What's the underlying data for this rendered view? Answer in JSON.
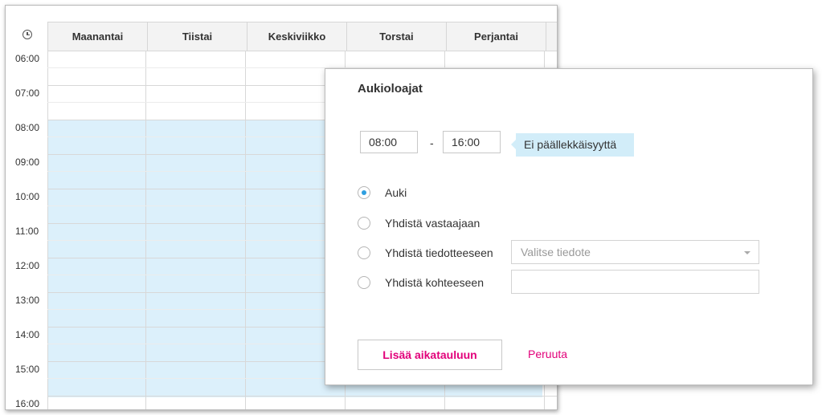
{
  "calendar": {
    "days": [
      "Maanantai",
      "Tiistai",
      "Keskiviikko",
      "Torstai",
      "Perjantai"
    ],
    "hours": [
      "06:00",
      "07:00",
      "08:00",
      "09:00",
      "10:00",
      "11:00",
      "12:00",
      "13:00",
      "14:00",
      "15:00",
      "16:00"
    ],
    "open_from": "08:00",
    "open_to": "16:00",
    "open_color": "#dcf0fb"
  },
  "dialog": {
    "title": "Aukioloajat",
    "start_time": "08:00",
    "separator": "-",
    "end_time": "16:00",
    "overlap_status": "Ei päällekkäisyyttä",
    "options": [
      {
        "label": "Auki",
        "checked": true
      },
      {
        "label": "Yhdistä vastaajaan",
        "checked": false
      },
      {
        "label": "Yhdistä tiedotteeseen",
        "checked": false
      },
      {
        "label": "Yhdistä kohteeseen",
        "checked": false
      }
    ],
    "bulletin_select_placeholder": "Valitse tiedote",
    "target_input_value": "",
    "add_button_label": "Lisää aikatauluun",
    "cancel_label": "Peruuta",
    "accent_color": "#e2007a"
  }
}
